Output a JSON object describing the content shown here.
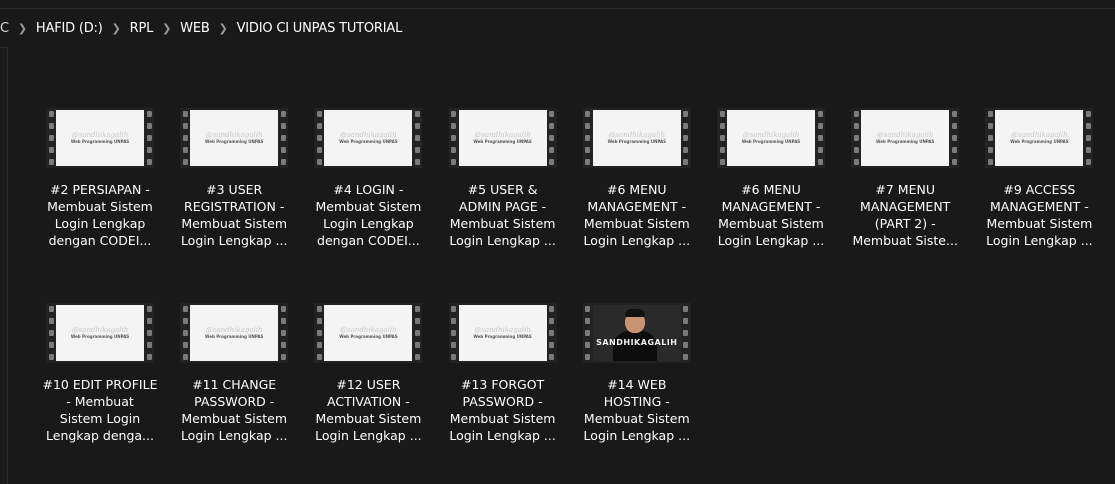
{
  "address_bar": {
    "crumbs": [
      "C",
      "HAFID (D:)",
      "RPL",
      "WEB",
      "VIDIO CI UNPAS TUTORIAL"
    ]
  },
  "thumbnail_watermark": {
    "line1": "@sandhikagalih",
    "line2": "Web Programming UNPAS"
  },
  "photo_overlay_text": "SANDHIKAGALIH",
  "files": [
    {
      "lines": [
        "#2 PERSIAPAN -",
        "Membuat Sistem",
        "Login Lengkap",
        "dengan CODEI..."
      ]
    },
    {
      "lines": [
        "#3 USER",
        "REGISTRATION -",
        "Membuat Sistem",
        "Login Lengkap ..."
      ]
    },
    {
      "lines": [
        "#4 LOGIN -",
        "Membuat Sistem",
        "Login Lengkap",
        "dengan CODEI..."
      ]
    },
    {
      "lines": [
        "#5 USER &",
        "ADMIN PAGE -",
        "Membuat Sistem",
        "Login Lengkap ..."
      ]
    },
    {
      "lines": [
        "#6 MENU",
        "MANAGEMENT -",
        "Membuat Sistem",
        "Login Lengkap ..."
      ]
    },
    {
      "lines": [
        "#6 MENU",
        "MANAGEMENT -",
        "Membuat Sistem",
        "Login Lengkap ..."
      ]
    },
    {
      "lines": [
        "#7 MENU",
        "MANAGEMENT",
        "(PART 2) -",
        "Membuat Siste..."
      ]
    },
    {
      "lines": [
        "#9 ACCESS",
        "MANAGEMENT -",
        "Membuat Sistem",
        "Login Lengkap ..."
      ]
    },
    {
      "lines": [
        "#10 EDIT PROFILE",
        "- Membuat",
        "Sistem Login",
        "Lengkap denga..."
      ]
    },
    {
      "lines": [
        "#11 CHANGE",
        "PASSWORD -",
        "Membuat Sistem",
        "Login Lengkap ..."
      ]
    },
    {
      "lines": [
        "#12 USER",
        "ACTIVATION -",
        "Membuat Sistem",
        "Login Lengkap ..."
      ]
    },
    {
      "lines": [
        "#13 FORGOT",
        "PASSWORD -",
        "Membuat Sistem",
        "Login Lengkap ..."
      ]
    },
    {
      "lines": [
        "#14 WEB",
        "HOSTING -",
        "Membuat Sistem",
        "Login Lengkap ..."
      ],
      "photo": true
    }
  ]
}
